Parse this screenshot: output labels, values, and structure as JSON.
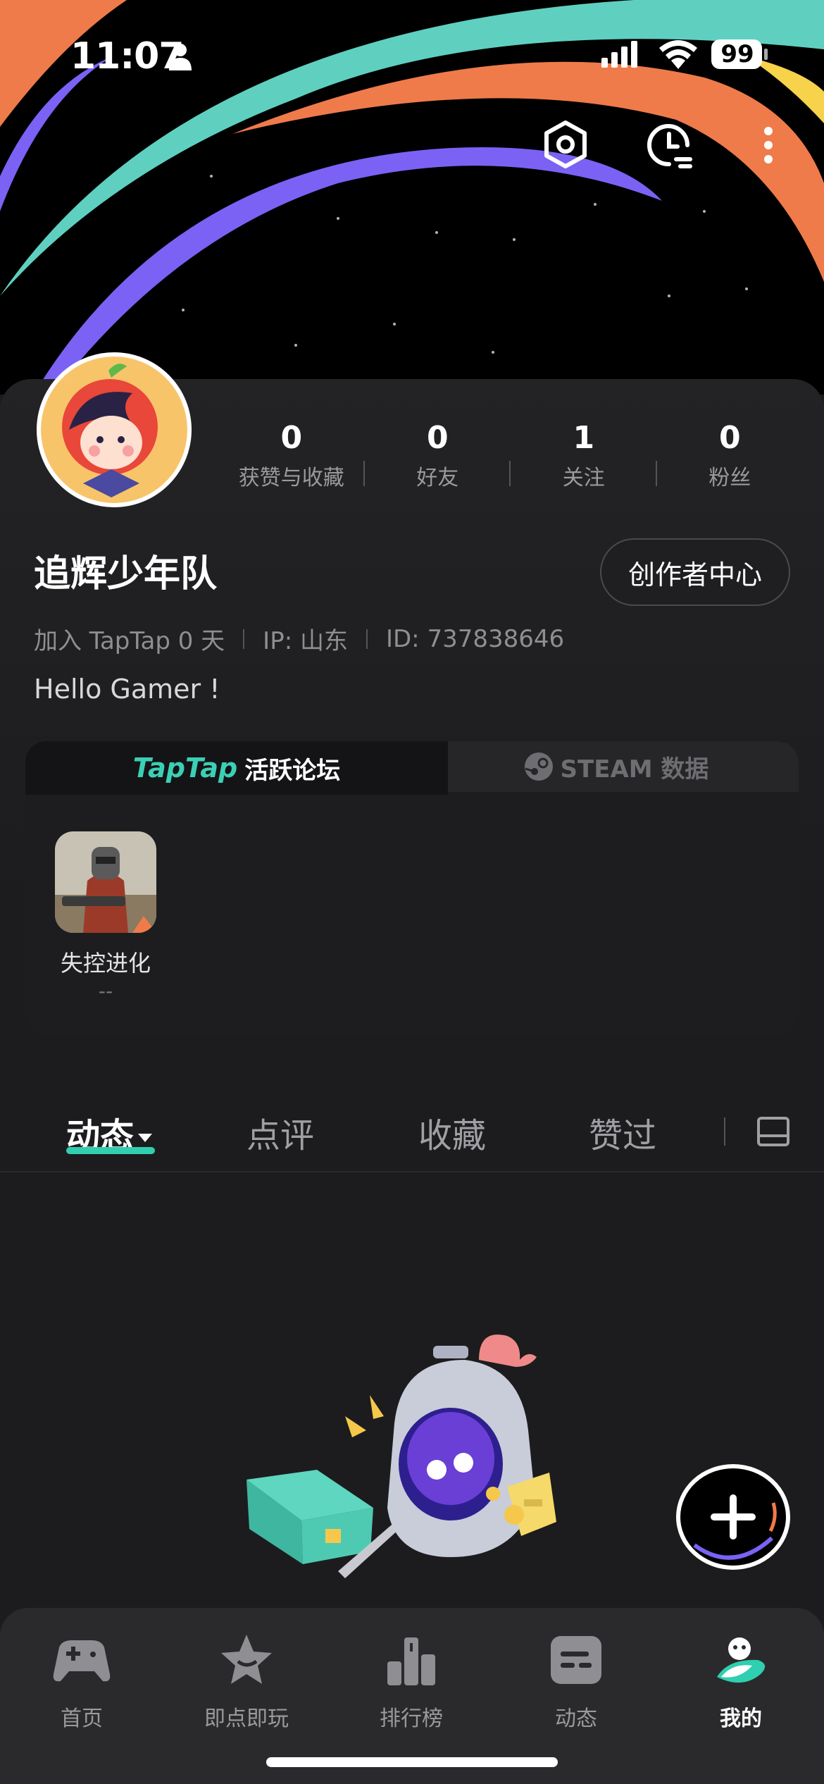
{
  "status_bar": {
    "time": "11:07",
    "battery": "99"
  },
  "profile": {
    "stats": [
      {
        "value": "0",
        "label": "获赞与收藏"
      },
      {
        "value": "0",
        "label": "好友"
      },
      {
        "value": "1",
        "label": "关注"
      },
      {
        "value": "0",
        "label": "粉丝"
      }
    ],
    "username": "追辉少年队",
    "creator_button": "创作者中心",
    "join_info": "加入 TapTap 0 天",
    "ip": "IP: 山东",
    "id": "ID: 737838646",
    "bio": "Hello Gamer !"
  },
  "forum": {
    "active_tab_brand": "TapTap",
    "active_tab_label": "活跃论坛",
    "inactive_tab_label": "STEAM 数据",
    "games": [
      {
        "name": "失控进化",
        "sub": "--"
      }
    ]
  },
  "content_tabs": [
    {
      "label": "动态"
    },
    {
      "label": "点评"
    },
    {
      "label": "收藏"
    },
    {
      "label": "赞过"
    }
  ],
  "bottom_nav": [
    {
      "label": "首页",
      "icon": "gamepad-icon"
    },
    {
      "label": "即点即玩",
      "icon": "star-icon"
    },
    {
      "label": "排行榜",
      "icon": "ranking-icon"
    },
    {
      "label": "动态",
      "icon": "feed-icon"
    },
    {
      "label": "我的",
      "icon": "profile-icon"
    }
  ],
  "colors": {
    "accent": "#2fcfb0",
    "background": "#1c1c1e",
    "nav": "#2a2a2c"
  }
}
